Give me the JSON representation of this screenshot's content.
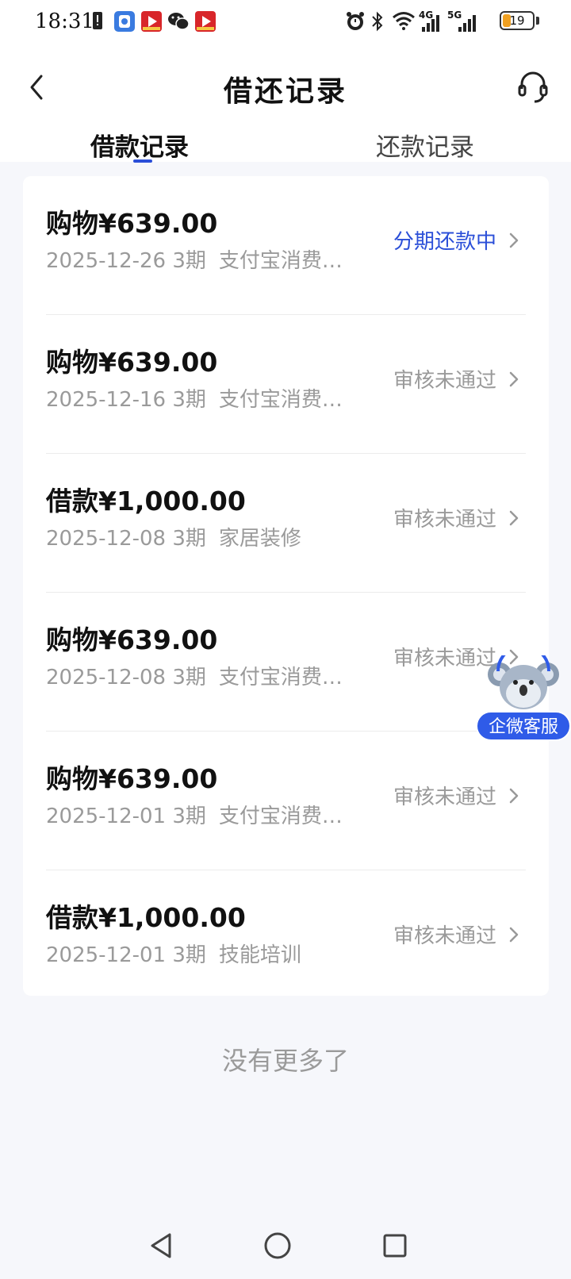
{
  "status_bar": {
    "time": "18:31",
    "network_4g": "4G",
    "network_5g": "5G",
    "battery_level": "19",
    "icons": [
      "sim-alert-icon",
      "app-shield-icon",
      "video-app-icon",
      "wechat-icon",
      "video-app-icon",
      "alarm-icon",
      "bluetooth-icon",
      "wifi-icon",
      "signal-icon",
      "signal-icon",
      "battery-icon"
    ]
  },
  "header": {
    "title": "借还记录",
    "back_icon": "chevron-left-icon",
    "service_icon": "headset-icon"
  },
  "tabs": [
    {
      "label": "借款记录",
      "active": true
    },
    {
      "label": "还款记录",
      "active": false
    }
  ],
  "records": [
    {
      "amount": "购物¥639.00",
      "date": "2025-12-26",
      "term": "3期",
      "purpose": "支付宝消费…",
      "status": "分期还款中",
      "status_color": "#2b4fd8"
    },
    {
      "amount": "购物¥639.00",
      "date": "2025-12-16",
      "term": "3期",
      "purpose": "支付宝消费…",
      "status": "审核未通过",
      "status_color": "#9a9a9a"
    },
    {
      "amount": "借款¥1,000.00",
      "date": "2025-12-08",
      "term": "3期",
      "purpose": "家居装修",
      "status": "审核未通过",
      "status_color": "#9a9a9a"
    },
    {
      "amount": "购物¥639.00",
      "date": "2025-12-08",
      "term": "3期",
      "purpose": "支付宝消费…",
      "status": "审核未通过",
      "status_color": "#9a9a9a"
    },
    {
      "amount": "购物¥639.00",
      "date": "2025-12-01",
      "term": "3期",
      "purpose": "支付宝消费…",
      "status": "审核未通过",
      "status_color": "#9a9a9a"
    },
    {
      "amount": "借款¥1,000.00",
      "date": "2025-12-01",
      "term": "3期",
      "purpose": "技能培训",
      "status": "审核未通过",
      "status_color": "#9a9a9a"
    }
  ],
  "footer": {
    "no_more": "没有更多了"
  },
  "floating_service": {
    "label": "企微客服",
    "icon": "koala-mascot-icon"
  },
  "nav_bar": {
    "buttons": [
      "back-triangle-icon",
      "home-circle-icon",
      "recents-square-icon"
    ]
  },
  "colors": {
    "accent": "#2b4fd8",
    "muted": "#9a9a9a",
    "background": "#f6f7fb"
  }
}
